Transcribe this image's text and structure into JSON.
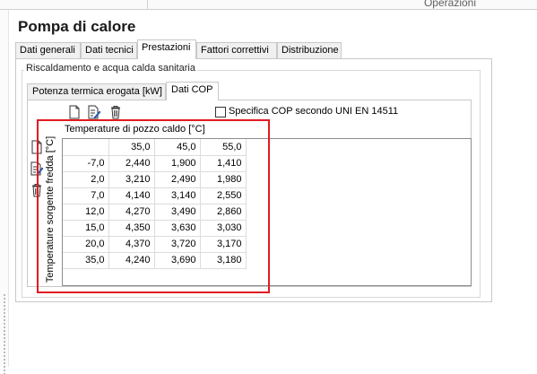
{
  "header": {
    "operations_label": "Operazioni"
  },
  "page": {
    "title": "Pompa di calore"
  },
  "tabs": [
    {
      "label": "Dati generali",
      "active": false
    },
    {
      "label": "Dati tecnici",
      "active": false
    },
    {
      "label": "Prestazioni",
      "active": true
    },
    {
      "label": "Fattori correttivi",
      "active": false
    },
    {
      "label": "Distribuzione",
      "active": false
    }
  ],
  "group": {
    "label": "Riscaldamento e acqua calda sanitaria"
  },
  "subtabs": [
    {
      "label": "Potenza termica erogata [kW]",
      "active": false
    },
    {
      "label": "Dati COP",
      "active": true
    }
  ],
  "toolbar": {
    "icons": [
      "new-document-icon",
      "edit-document-icon",
      "delete-icon"
    ]
  },
  "row_toolbar": {
    "icons": [
      "new-row-icon",
      "edit-row-icon",
      "delete-row-icon"
    ]
  },
  "checkbox": {
    "label": "Specifica COP secondo UNI EN 14511",
    "checked": false
  },
  "grid": {
    "col_header_label": "Temperature di pozzo caldo [°C]",
    "row_header_label": "Temperature sorgente fredda [°C]",
    "columns": [
      "",
      "35,0",
      "45,0",
      "55,0"
    ],
    "rows": [
      [
        "-7,0",
        "2,440",
        "1,900",
        "1,410"
      ],
      [
        "2,0",
        "3,210",
        "2,490",
        "1,980"
      ],
      [
        "7,0",
        "4,140",
        "3,140",
        "2,550"
      ],
      [
        "12,0",
        "4,270",
        "3,490",
        "2,860"
      ],
      [
        "15,0",
        "4,350",
        "3,630",
        "3,030"
      ],
      [
        "20,0",
        "4,370",
        "3,720",
        "3,170"
      ],
      [
        "35,0",
        "4,240",
        "3,690",
        "3,180"
      ]
    ]
  },
  "colors": {
    "highlight": "#e21a22"
  }
}
